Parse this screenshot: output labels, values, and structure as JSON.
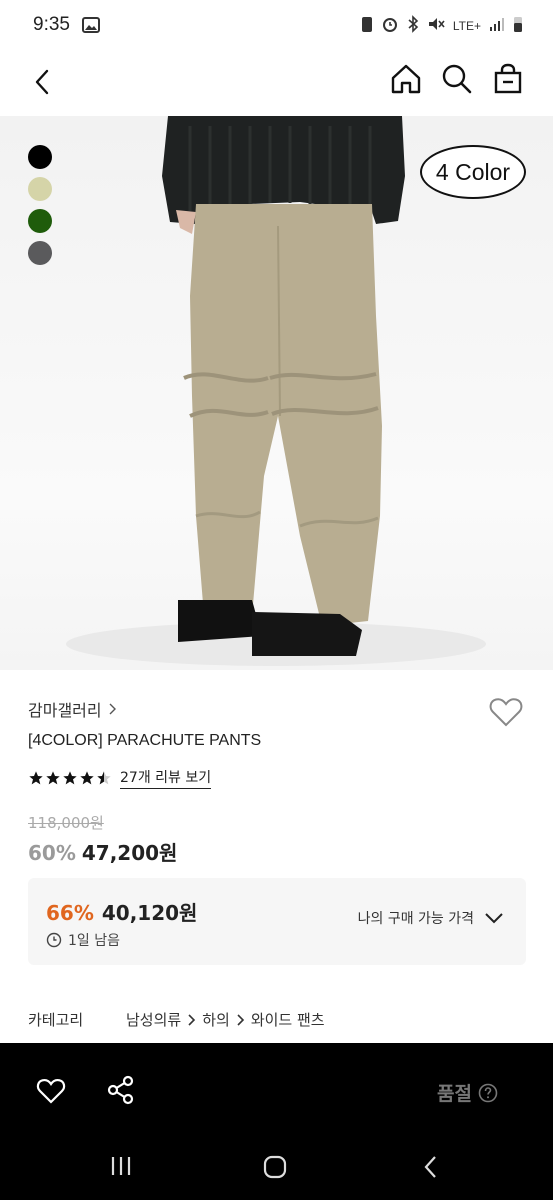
{
  "status": {
    "time": "9:35",
    "network": "LTE+"
  },
  "header": {
    "back": "back",
    "home": "home",
    "search": "search",
    "bag": "shopping-bag"
  },
  "hero": {
    "badge": "4 Color",
    "swatches": [
      "#000000",
      "#d5d4a8",
      "#1f5c0b",
      "#5a5a5c"
    ]
  },
  "product": {
    "brand": "감마갤러리",
    "title": "[4COLOR] PARACHUTE PANTS",
    "rating": 4.5,
    "review_link": "27개 리뷰 보기",
    "original_price": "118,000원",
    "discount": "60%",
    "price": "47,200원"
  },
  "coupon": {
    "discount": "66%",
    "price": "40,120원",
    "time_left": "1일 남음",
    "toggle_label": "나의 구매 가능 가격",
    "accent": "#e0661f"
  },
  "category": {
    "label": "카테고리",
    "path": [
      "남성의류",
      "하의",
      "와이드 팬츠"
    ]
  },
  "bottom": {
    "soldout": "품절"
  }
}
